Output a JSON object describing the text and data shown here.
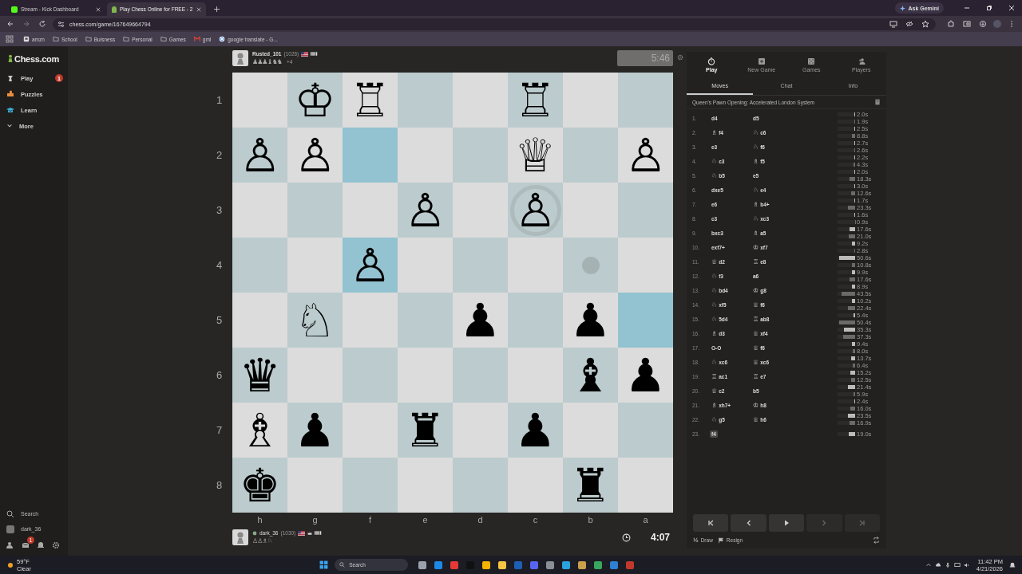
{
  "browser": {
    "tabs": [
      {
        "title": "Stream - Kick Dashboard",
        "selected": false,
        "kind": "kick"
      },
      {
        "title": "Play Chess Online for FREE - 2",
        "selected": true,
        "kind": "chess"
      }
    ],
    "ask_button": "Ask Gemini",
    "url": "chess.com/game/167649664794",
    "bookmarks": [
      {
        "label": "amzn",
        "kind": "site"
      },
      {
        "label": "School",
        "kind": "folder"
      },
      {
        "label": "Buisness",
        "kind": "folder"
      },
      {
        "label": "Personal",
        "kind": "folder"
      },
      {
        "label": "Games",
        "kind": "folder"
      },
      {
        "label": "gml",
        "kind": "mail"
      },
      {
        "label": "google translate - G...",
        "kind": "google"
      }
    ]
  },
  "sidebar": {
    "logo": "Chess.com",
    "nav": [
      {
        "label": "Play",
        "kind": "play",
        "badge": "1"
      },
      {
        "label": "Puzzles",
        "kind": "puzzles"
      },
      {
        "label": "Learn",
        "kind": "learn"
      },
      {
        "label": "More",
        "kind": "more"
      }
    ],
    "search": "Search",
    "user": "dark_36",
    "mail_badge": "1"
  },
  "top_player": {
    "name": "Rusted_101",
    "rating": "(1026)",
    "captured": "♟♟♟♝♞♞",
    "advantage": "+4",
    "clock": "5:46",
    "active": false
  },
  "board": {
    "ranks": [
      {
        "label": "1",
        "squares": [
          {
            "highlighted": false,
            "kind": "plain"
          },
          {
            "highlighted": false,
            "kind": "plain",
            "piece": "♔"
          },
          {
            "highlighted": false,
            "kind": "plain",
            "piece": "♖"
          },
          {
            "highlighted": false,
            "kind": "plain"
          },
          {
            "highlighted": false,
            "kind": "plain"
          },
          {
            "highlighted": false,
            "kind": "plain",
            "piece": "♖"
          },
          {
            "highlighted": false,
            "kind": "plain"
          },
          {
            "highlighted": false,
            "kind": "plain"
          }
        ]
      },
      {
        "label": "2",
        "squares": [
          {
            "highlighted": false,
            "kind": "plain",
            "piece": "♙"
          },
          {
            "highlighted": false,
            "kind": "plain",
            "piece": "♙"
          },
          {
            "highlighted": true,
            "kind": "plain"
          },
          {
            "highlighted": false,
            "kind": "plain"
          },
          {
            "highlighted": false,
            "kind": "plain"
          },
          {
            "highlighted": false,
            "kind": "plain",
            "piece": "♕"
          },
          {
            "highlighted": false,
            "kind": "plain"
          },
          {
            "highlighted": false,
            "kind": "plain",
            "piece": "♙"
          }
        ]
      },
      {
        "label": "3",
        "squares": [
          {
            "highlighted": false,
            "kind": "plain"
          },
          {
            "highlighted": false,
            "kind": "plain"
          },
          {
            "highlighted": false,
            "kind": "plain"
          },
          {
            "highlighted": false,
            "kind": "plain",
            "piece": "♙"
          },
          {
            "highlighted": false,
            "kind": "plain"
          },
          {
            "highlighted": false,
            "kind": "ring",
            "piece": "♙"
          },
          {
            "highlighted": false,
            "kind": "plain"
          },
          {
            "highlighted": false,
            "kind": "plain"
          }
        ]
      },
      {
        "label": "4",
        "squares": [
          {
            "highlighted": false,
            "kind": "plain"
          },
          {
            "highlighted": false,
            "kind": "plain"
          },
          {
            "highlighted": true,
            "kind": "plain",
            "piece": "♙"
          },
          {
            "highlighted": false,
            "kind": "plain"
          },
          {
            "highlighted": false,
            "kind": "plain"
          },
          {
            "highlighted": false,
            "kind": "plain"
          },
          {
            "highlighted": false,
            "kind": "dot"
          },
          {
            "highlighted": false,
            "kind": "plain"
          }
        ]
      },
      {
        "label": "5",
        "squares": [
          {
            "highlighted": false,
            "kind": "plain"
          },
          {
            "highlighted": false,
            "kind": "plain",
            "piece": "♘"
          },
          {
            "highlighted": false,
            "kind": "plain"
          },
          {
            "highlighted": false,
            "kind": "plain"
          },
          {
            "highlighted": false,
            "kind": "plain",
            "piece": "♟"
          },
          {
            "highlighted": false,
            "kind": "plain"
          },
          {
            "highlighted": false,
            "kind": "plain",
            "piece": "♟"
          },
          {
            "highlighted": true,
            "kind": "plain"
          }
        ]
      },
      {
        "label": "6",
        "squares": [
          {
            "highlighted": false,
            "kind": "plain",
            "piece": "♛"
          },
          {
            "highlighted": false,
            "kind": "plain"
          },
          {
            "highlighted": false,
            "kind": "plain"
          },
          {
            "highlighted": false,
            "kind": "plain"
          },
          {
            "highlighted": false,
            "kind": "plain"
          },
          {
            "highlighted": false,
            "kind": "plain"
          },
          {
            "highlighted": false,
            "kind": "plain",
            "piece": "♝"
          },
          {
            "highlighted": false,
            "kind": "plain",
            "piece": "♟"
          }
        ]
      },
      {
        "label": "7",
        "squares": [
          {
            "highlighted": false,
            "kind": "plain",
            "piece": "♗"
          },
          {
            "highlighted": false,
            "kind": "plain",
            "piece": "♟"
          },
          {
            "highlighted": false,
            "kind": "plain"
          },
          {
            "highlighted": false,
            "kind": "plain",
            "piece": "♜"
          },
          {
            "highlighted": false,
            "kind": "plain"
          },
          {
            "highlighted": false,
            "kind": "plain",
            "piece": "♟"
          },
          {
            "highlighted": false,
            "kind": "plain"
          },
          {
            "highlighted": false,
            "kind": "plain"
          }
        ]
      },
      {
        "label": "8",
        "squares": [
          {
            "highlighted": false,
            "kind": "plain",
            "piece": "♚"
          },
          {
            "highlighted": false,
            "kind": "plain"
          },
          {
            "highlighted": false,
            "kind": "plain"
          },
          {
            "highlighted": false,
            "kind": "plain"
          },
          {
            "highlighted": false,
            "kind": "plain"
          },
          {
            "highlighted": false,
            "kind": "plain"
          },
          {
            "highlighted": false,
            "kind": "plain",
            "piece": "♜"
          },
          {
            "highlighted": false,
            "kind": "plain"
          }
        ]
      }
    ],
    "files": [
      "h",
      "g",
      "f",
      "e",
      "d",
      "c",
      "b",
      "a"
    ]
  },
  "bottom_player": {
    "name": "dark_36",
    "rating": "(1030)",
    "captured": "♙♙♗♘",
    "clock": "4:07",
    "active": true
  },
  "panel": {
    "nav": [
      {
        "label": "Play",
        "kind": "clock",
        "selected": true
      },
      {
        "label": "New Game",
        "kind": "plus",
        "selected": false
      },
      {
        "label": "Games",
        "kind": "dice",
        "selected": false
      },
      {
        "label": "Players",
        "kind": "people",
        "selected": false
      }
    ],
    "tabs": [
      {
        "label": "Moves",
        "selected": true
      },
      {
        "label": "Chat",
        "selected": false
      },
      {
        "label": "Info",
        "selected": false
      }
    ],
    "opening": "Queen's Pawn Opening: Accelerated London System",
    "moves": [
      {
        "n": "1.",
        "w": {
          "san": "d4",
          "selected": false
        },
        "b": {
          "san": "d5",
          "selected": false
        },
        "times": [
          {
            "t": "2.0s",
            "level": 0.04
          },
          {
            "t": "1.9s",
            "level": 0.03
          }
        ]
      },
      {
        "n": "2.",
        "w": {
          "fig": "♗",
          "san": "f4",
          "selected": false
        },
        "b": {
          "fig": "♘",
          "san": "c6",
          "selected": false
        },
        "times": [
          {
            "t": "2.5s",
            "level": 0.05
          },
          {
            "t": "8.8s",
            "level": 0.16
          }
        ]
      },
      {
        "n": "3.",
        "w": {
          "san": "e3",
          "selected": false
        },
        "b": {
          "fig": "♘",
          "san": "f6",
          "selected": false
        },
        "times": [
          {
            "t": "2.7s",
            "level": 0.05
          },
          {
            "t": "2.6s",
            "level": 0.05
          }
        ]
      },
      {
        "n": "4.",
        "w": {
          "fig": "♘",
          "san": "c3",
          "selected": false
        },
        "b": {
          "fig": "♗",
          "san": "f5",
          "selected": false
        },
        "times": [
          {
            "t": "2.2s",
            "level": 0.04
          },
          {
            "t": "4.3s",
            "level": 0.08
          }
        ]
      },
      {
        "n": "5.",
        "w": {
          "fig": "♘",
          "san": "b5",
          "selected": false
        },
        "b": {
          "san": "e5",
          "selected": false
        },
        "times": [
          {
            "t": "2.0s",
            "level": 0.04
          },
          {
            "t": "18.3s",
            "level": 0.33
          }
        ]
      },
      {
        "n": "6.",
        "w": {
          "san": "dxe5",
          "selected": false
        },
        "b": {
          "fig": "♘",
          "san": "e4",
          "selected": false
        },
        "times": [
          {
            "t": "3.0s",
            "level": 0.05
          },
          {
            "t": "12.6s",
            "level": 0.23
          }
        ]
      },
      {
        "n": "7.",
        "w": {
          "san": "e6",
          "selected": false
        },
        "b": {
          "fig": "♗",
          "san": "b4+",
          "selected": false
        },
        "times": [
          {
            "t": "1.7s",
            "level": 0.03
          },
          {
            "t": "23.3s",
            "level": 0.42
          }
        ]
      },
      {
        "n": "8.",
        "w": {
          "san": "c3",
          "selected": false
        },
        "b": {
          "fig": "♘",
          "san": "xc3",
          "selected": false
        },
        "times": [
          {
            "t": "1.6s",
            "level": 0.03
          },
          {
            "t": "0.9s",
            "level": 0.02
          }
        ]
      },
      {
        "n": "9.",
        "w": {
          "san": "bxc3",
          "selected": false
        },
        "b": {
          "fig": "♗",
          "san": "a5",
          "selected": false
        },
        "times": [
          {
            "t": "17.6s",
            "level": 0.32
          },
          {
            "t": "21.0s",
            "level": 0.38
          }
        ]
      },
      {
        "n": "10.",
        "w": {
          "san": "exf7+",
          "selected": false
        },
        "b": {
          "fig": "♔",
          "san": "xf7",
          "selected": false
        },
        "times": [
          {
            "t": "9.2s",
            "level": 0.17
          },
          {
            "t": "2.8s",
            "level": 0.05
          }
        ]
      },
      {
        "n": "11.",
        "w": {
          "fig": "♕",
          "san": "d2",
          "selected": false
        },
        "b": {
          "fig": "♖",
          "san": "e8",
          "selected": false
        },
        "times": [
          {
            "t": "50.6s",
            "level": 0.92
          },
          {
            "t": "10.8s",
            "level": 0.2
          }
        ]
      },
      {
        "n": "12.",
        "w": {
          "fig": "♘",
          "san": "f3",
          "selected": false
        },
        "b": {
          "san": "a6",
          "selected": false
        },
        "times": [
          {
            "t": "9.9s",
            "level": 0.18
          },
          {
            "t": "17.6s",
            "level": 0.32
          }
        ]
      },
      {
        "n": "13.",
        "w": {
          "fig": "♘",
          "san": "bd4",
          "selected": false
        },
        "b": {
          "fig": "♔",
          "san": "g8",
          "selected": false
        },
        "times": [
          {
            "t": "8.9s",
            "level": 0.16
          },
          {
            "t": "43.5s",
            "level": 0.79
          }
        ]
      },
      {
        "n": "14.",
        "w": {
          "fig": "♘",
          "san": "xf5",
          "selected": false
        },
        "b": {
          "fig": "♕",
          "san": "f6",
          "selected": false
        },
        "times": [
          {
            "t": "10.2s",
            "level": 0.19
          },
          {
            "t": "22.4s",
            "level": 0.41
          }
        ]
      },
      {
        "n": "15.",
        "w": {
          "fig": "♘",
          "san": "5d4",
          "selected": false
        },
        "b": {
          "fig": "♖",
          "san": "ab8",
          "selected": false
        },
        "times": [
          {
            "t": "5.4s",
            "level": 0.1
          },
          {
            "t": "50.4s",
            "level": 0.92
          }
        ]
      },
      {
        "n": "16.",
        "w": {
          "fig": "♗",
          "san": "d3",
          "selected": false
        },
        "b": {
          "fig": "♕",
          "san": "xf4",
          "selected": false
        },
        "times": [
          {
            "t": "35.3s",
            "level": 0.64
          },
          {
            "t": "37.3s",
            "level": 0.68
          }
        ]
      },
      {
        "n": "17.",
        "w": {
          "san": "O-O",
          "selected": false
        },
        "b": {
          "fig": "♕",
          "san": "f6",
          "selected": false
        },
        "times": [
          {
            "t": "9.4s",
            "level": 0.17
          },
          {
            "t": "8.0s",
            "level": 0.15
          }
        ]
      },
      {
        "n": "18.",
        "w": {
          "fig": "♘",
          "san": "xc6",
          "selected": false
        },
        "b": {
          "fig": "♕",
          "san": "xc6",
          "selected": false
        },
        "times": [
          {
            "t": "13.7s",
            "level": 0.25
          },
          {
            "t": "6.4s",
            "level": 0.12
          }
        ]
      },
      {
        "n": "19.",
        "w": {
          "fig": "♖",
          "san": "ac1",
          "selected": false
        },
        "b": {
          "fig": "♖",
          "san": "e7",
          "selected": false
        },
        "times": [
          {
            "t": "15.2s",
            "level": 0.28
          },
          {
            "t": "12.5s",
            "level": 0.23
          }
        ]
      },
      {
        "n": "20.",
        "w": {
          "fig": "♕",
          "san": "c2",
          "selected": false
        },
        "b": {
          "san": "b5",
          "selected": false
        },
        "times": [
          {
            "t": "21.4s",
            "level": 0.39
          },
          {
            "t": "5.9s",
            "level": 0.11
          }
        ]
      },
      {
        "n": "21.",
        "w": {
          "fig": "♗",
          "san": "xh7+",
          "selected": false
        },
        "b": {
          "fig": "♔",
          "san": "h8",
          "selected": false
        },
        "times": [
          {
            "t": "2.4s",
            "level": 0.04
          },
          {
            "t": "16.0s",
            "level": 0.29
          }
        ]
      },
      {
        "n": "22.",
        "w": {
          "fig": "♘",
          "san": "g5",
          "selected": false
        },
        "b": {
          "fig": "♕",
          "san": "h6",
          "selected": false
        },
        "times": [
          {
            "t": "23.5s",
            "level": 0.43
          },
          {
            "t": "16.9s",
            "level": 0.31
          }
        ]
      },
      {
        "n": "23.",
        "w": {
          "san": "f4",
          "selected": true
        },
        "times": [
          {
            "t": "19.0s",
            "level": 0.35
          }
        ]
      }
    ],
    "controls": [
      {
        "kind": "first",
        "disabled": false
      },
      {
        "kind": "prev",
        "disabled": false
      },
      {
        "kind": "play",
        "disabled": false
      },
      {
        "kind": "next",
        "disabled": true
      },
      {
        "kind": "last",
        "disabled": true
      }
    ],
    "draw_symbol": "½",
    "draw": "Draw",
    "resign": "Resign"
  },
  "taskbar": {
    "temp": "59°F",
    "weather": "Clear",
    "search": "Search",
    "time": "11:42 PM",
    "date": "4/21/2026"
  }
}
